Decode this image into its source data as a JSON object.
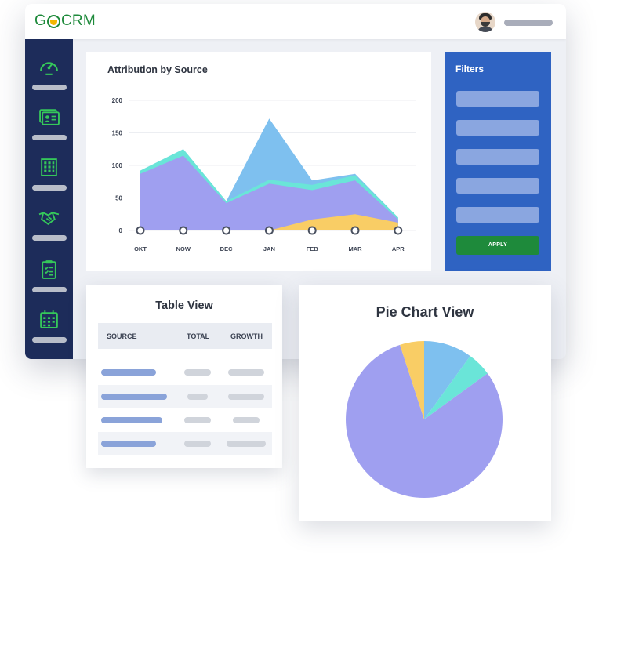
{
  "app": {
    "logo_part1": "G",
    "logo_part2": "CRM"
  },
  "sidebar": {
    "items": [
      {
        "icon": "speedometer-icon"
      },
      {
        "icon": "contact-card-icon"
      },
      {
        "icon": "building-icon"
      },
      {
        "icon": "handshake-icon"
      },
      {
        "icon": "clipboard-checklist-icon"
      },
      {
        "icon": "calendar-icon"
      }
    ]
  },
  "attribution": {
    "title": "Attribution by Source"
  },
  "filters": {
    "title": "Filters",
    "field_count": 5,
    "apply_label": "APPLY"
  },
  "table_view": {
    "title": "Table View",
    "columns": [
      "SOURCE",
      "TOTAL",
      "GROWTH"
    ],
    "row_count": 4
  },
  "pie_view": {
    "title": "Pie Chart View"
  },
  "colors": {
    "sidebar": "#1d2c5a",
    "accent_green": "#1e8a3b",
    "filters_panel": "#2f63c2",
    "series_purple": "#9f9ff0",
    "series_teal": "#6ae5d8",
    "series_blue": "#7ec0ef",
    "series_yellow": "#f9cd65"
  },
  "chart_data": [
    {
      "type": "area",
      "title": "Attribution by Source",
      "categories": [
        "OKT",
        "NOW",
        "DEC",
        "JAN",
        "FEB",
        "MAR",
        "APR"
      ],
      "yticks": [
        0,
        50,
        100,
        150,
        200
      ],
      "ylim": [
        0,
        200
      ],
      "grid": true,
      "series": [
        {
          "color": "#f9cd65",
          "values": [
            0,
            0,
            0,
            0,
            17,
            25,
            12
          ]
        },
        {
          "color": "#9f9ff0",
          "values": [
            87,
            115,
            42,
            72,
            62,
            77,
            17
          ]
        },
        {
          "color": "#6ae5d8",
          "values": [
            92,
            125,
            45,
            78,
            70,
            85,
            20
          ]
        },
        {
          "color": "#7ec0ef",
          "values": [
            92,
            125,
            45,
            172,
            77,
            87,
            20
          ]
        }
      ]
    },
    {
      "type": "pie",
      "title": "Pie Chart View",
      "slices": [
        {
          "color": "#7ec0ef",
          "value": 10
        },
        {
          "color": "#6ae5d8",
          "value": 5
        },
        {
          "color": "#9f9ff0",
          "value": 80
        },
        {
          "color": "#f9cd65",
          "value": 5
        }
      ]
    }
  ]
}
